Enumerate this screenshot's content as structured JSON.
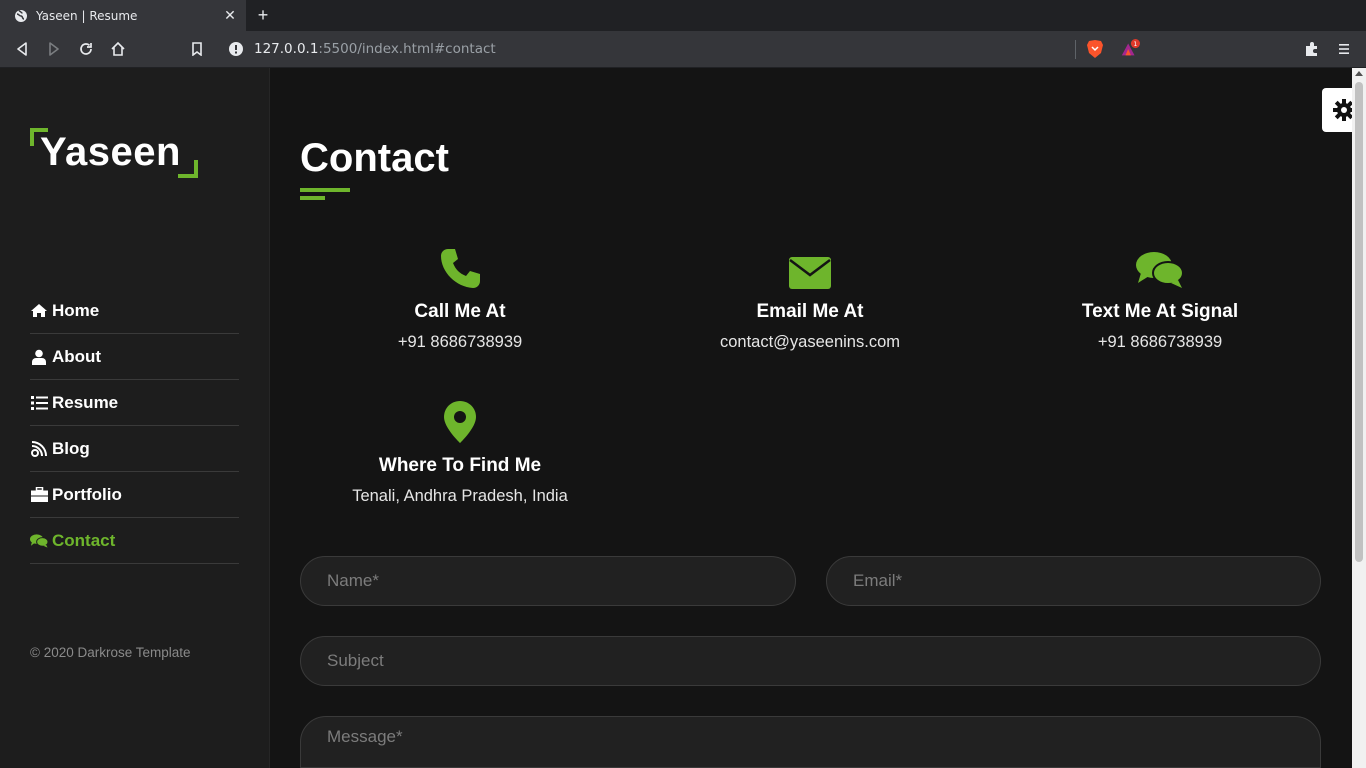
{
  "browser": {
    "tab_title": "Yaseen | Resume",
    "url_host": "127.0.0.1",
    "url_rest": ":5500/index.html#contact",
    "notification_count": "1"
  },
  "sidebar": {
    "logo": "Yaseen",
    "items": [
      {
        "label": "Home",
        "icon": "home-icon"
      },
      {
        "label": "About",
        "icon": "user-icon"
      },
      {
        "label": "Resume",
        "icon": "list-icon"
      },
      {
        "label": "Blog",
        "icon": "blog-icon"
      },
      {
        "label": "Portfolio",
        "icon": "briefcase-icon"
      },
      {
        "label": "Contact",
        "icon": "chat-icon",
        "active": true
      }
    ],
    "copyright": "© 2020 Darkrose Template"
  },
  "main": {
    "title": "Contact",
    "info": [
      {
        "heading": "Call Me At",
        "value": "+91 8686738939",
        "icon": "phone-icon"
      },
      {
        "heading": "Email Me At",
        "value": "contact@yaseenins.com",
        "icon": "envelope-icon"
      },
      {
        "heading": "Text Me At Signal",
        "value": "+91 8686738939",
        "icon": "comments-icon"
      },
      {
        "heading": "Where To Find Me",
        "value": "Tenali, Andhra Pradesh, India",
        "icon": "map-pin-icon"
      }
    ],
    "form": {
      "name_placeholder": "Name*",
      "email_placeholder": "Email*",
      "subject_placeholder": "Subject",
      "message_placeholder": "Message*"
    }
  },
  "colors": {
    "accent": "#6eb52c",
    "background": "#141414",
    "sidebar": "#1d1d1d"
  }
}
